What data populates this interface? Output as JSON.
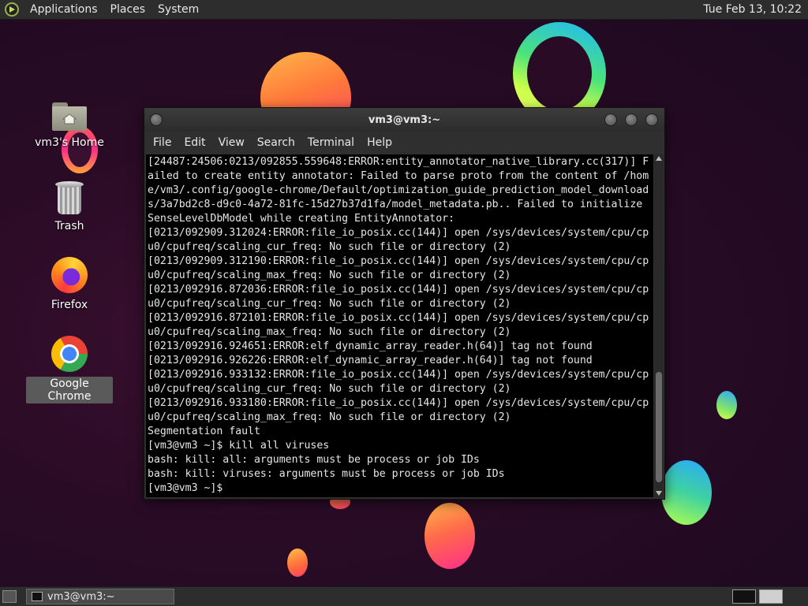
{
  "top_panel": {
    "menus": [
      "Applications",
      "Places",
      "System"
    ],
    "clock": "Tue Feb 13, 10:22"
  },
  "desktop": {
    "icons": [
      {
        "label": "vm3's Home",
        "icon": "home-folder-icon"
      },
      {
        "label": "Trash",
        "icon": "trash-icon"
      },
      {
        "label": "Firefox",
        "icon": "firefox-icon"
      },
      {
        "label": "Google Chrome",
        "icon": "chrome-icon",
        "selected": true
      }
    ]
  },
  "terminal": {
    "title": "vm3@vm3:~",
    "menus": [
      "File",
      "Edit",
      "View",
      "Search",
      "Terminal",
      "Help"
    ],
    "lines": [
      "[24487:24506:0213/092855.559648:ERROR:entity_annotator_native_library.cc(317)] F",
      "ailed to create entity annotator: Failed to parse proto from the content of /hom",
      "e/vm3/.config/google-chrome/Default/optimization_guide_prediction_model_download",
      "s/3a7bd2c8-d9c0-4a72-81fc-15d27b37d1fa/model_metadata.pb.. Failed to initialize",
      "SenseLevelDbModel while creating EntityAnnotator:",
      "[0213/092909.312024:ERROR:file_io_posix.cc(144)] open /sys/devices/system/cpu/cp",
      "u0/cpufreq/scaling_cur_freq: No such file or directory (2)",
      "[0213/092909.312190:ERROR:file_io_posix.cc(144)] open /sys/devices/system/cpu/cp",
      "u0/cpufreq/scaling_max_freq: No such file or directory (2)",
      "[0213/092916.872036:ERROR:file_io_posix.cc(144)] open /sys/devices/system/cpu/cp",
      "u0/cpufreq/scaling_cur_freq: No such file or directory (2)",
      "[0213/092916.872101:ERROR:file_io_posix.cc(144)] open /sys/devices/system/cpu/cp",
      "u0/cpufreq/scaling_max_freq: No such file or directory (2)",
      "[0213/092916.924651:ERROR:elf_dynamic_array_reader.h(64)] tag not found",
      "[0213/092916.926226:ERROR:elf_dynamic_array_reader.h(64)] tag not found",
      "[0213/092916.933132:ERROR:file_io_posix.cc(144)] open /sys/devices/system/cpu/cp",
      "u0/cpufreq/scaling_cur_freq: No such file or directory (2)",
      "[0213/092916.933180:ERROR:file_io_posix.cc(144)] open /sys/devices/system/cpu/cp",
      "u0/cpufreq/scaling_max_freq: No such file or directory (2)",
      "Segmentation fault",
      "[vm3@vm3 ~]$ kill all viruses",
      "bash: kill: all: arguments must be process or job IDs",
      "bash: kill: viruses: arguments must be process or job IDs",
      "[vm3@vm3 ~]$"
    ]
  },
  "taskbar": {
    "window_button": "vm3@vm3:~",
    "workspaces": [
      "active",
      "inactive"
    ]
  }
}
